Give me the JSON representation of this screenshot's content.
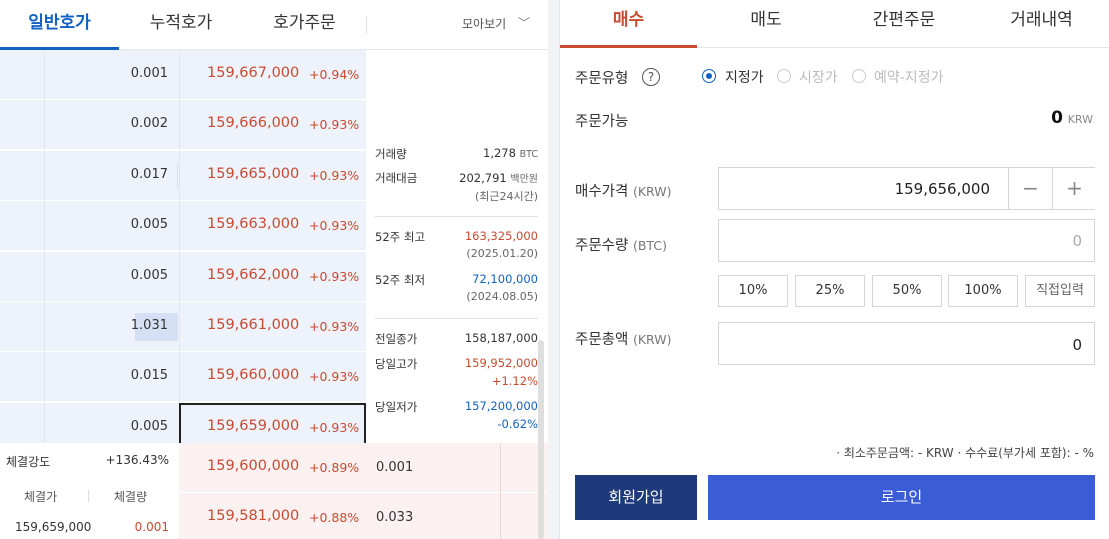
{
  "left_tabs": [
    "일반호가",
    "누적호가",
    "호가주문"
  ],
  "gather": "모아보기",
  "asks": [
    {
      "qty": "0.001",
      "price": "159,667,000",
      "change": "+0.94%",
      "fill": 0.0
    },
    {
      "qty": "0.002",
      "price": "159,666,000",
      "change": "+0.93%",
      "fill": 0.0
    },
    {
      "qty": "0.017",
      "price": "159,665,000",
      "change": "+0.93%",
      "fill": 0.01
    },
    {
      "qty": "0.005",
      "price": "159,663,000",
      "change": "+0.93%",
      "fill": 0.0
    },
    {
      "qty": "0.005",
      "price": "159,662,000",
      "change": "+0.93%",
      "fill": 0.0
    },
    {
      "qty": "1.031",
      "price": "159,661,000",
      "change": "+0.93%",
      "fill": 0.32
    },
    {
      "qty": "0.015",
      "price": "159,660,000",
      "change": "+0.93%",
      "fill": 0.0
    },
    {
      "qty": "0.005",
      "price": "159,659,000",
      "change": "+0.93%",
      "fill": 0.0
    }
  ],
  "bids": [
    {
      "qty": "0.001",
      "price": "159,600,000",
      "change": "+0.89%"
    },
    {
      "qty": "0.033",
      "price": "159,581,000",
      "change": "+0.88%"
    }
  ],
  "info": {
    "volume_label": "거래량",
    "volume_value": "1,278",
    "volume_unit": "BTC",
    "amount_label": "거래대금",
    "amount_value": "202,791",
    "amount_unit": "백만원",
    "amount_note": "(최근24시간)",
    "high52_label": "52주 최고",
    "high52_value": "163,325,000",
    "high52_date": "(2025.01.20)",
    "low52_label": "52주 최저",
    "low52_value": "72,100,000",
    "low52_date": "(2024.08.05)",
    "prev_close_label": "전일종가",
    "prev_close_value": "158,187,000",
    "day_high_label": "당일고가",
    "day_high_value": "159,952,000",
    "day_high_pct": "+1.12%",
    "day_low_label": "당일저가",
    "day_low_value": "157,200,000",
    "day_low_pct": "-0.62%"
  },
  "trade_strength": {
    "label": "체결강도",
    "value": "+136.43%"
  },
  "trades_header": {
    "price": "체결가",
    "qty": "체결량"
  },
  "trades": [
    {
      "price": "159,659,000",
      "qty": "0.001"
    }
  ],
  "right_tabs": [
    "매수",
    "매도",
    "간편주문",
    "거래내역"
  ],
  "order": {
    "type_label": "주문유형",
    "type_options": [
      "지정가",
      "시장가",
      "예약-지정가"
    ],
    "available_label": "주문가능",
    "available_value": "0",
    "available_unit": "KRW",
    "price_label": "매수가격",
    "price_unit": "(KRW)",
    "price_value": "159,656,000",
    "qty_label": "주문수량",
    "qty_unit": "(BTC)",
    "qty_value": "0",
    "pct_buttons": [
      "10%",
      "25%",
      "50%",
      "100%",
      "직접입력"
    ],
    "total_label": "주문총액",
    "total_unit": "(KRW)",
    "total_value": "0",
    "fee_text": "·  최소주문금액: - KRW   ·  수수료(부가세 포함): - %",
    "join_label": "회원가입",
    "login_label": "로그인"
  }
}
